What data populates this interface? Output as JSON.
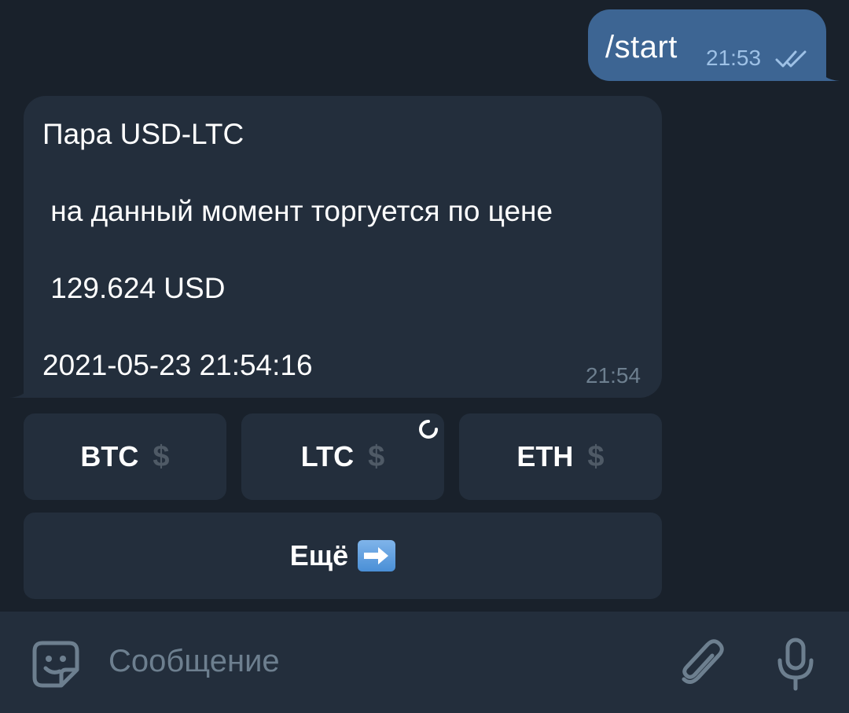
{
  "outgoing": {
    "text": "/start",
    "time": "21:53",
    "status_icon": "double-check-icon"
  },
  "incoming": {
    "lines": [
      "Пара USD-LTC",
      " на данный момент торгуется по цене",
      " 129.624 USD",
      "2021-05-23 21:54:16"
    ],
    "time": "21:54"
  },
  "keyboard": {
    "row1": [
      {
        "label": "BTC",
        "icon": "$"
      },
      {
        "label": "LTC",
        "icon": "$"
      },
      {
        "label": "ETH",
        "icon": "$"
      }
    ],
    "more_label": "Ещё",
    "more_icon": "right-arrow-emoji"
  },
  "composer": {
    "placeholder": "Сообщение"
  },
  "colors": {
    "background": "#19212b",
    "outgoing_bubble": "#3d6593",
    "incoming_bubble": "#232e3c",
    "accent": "#9ec1e6",
    "muted": "#6d7f8f"
  }
}
